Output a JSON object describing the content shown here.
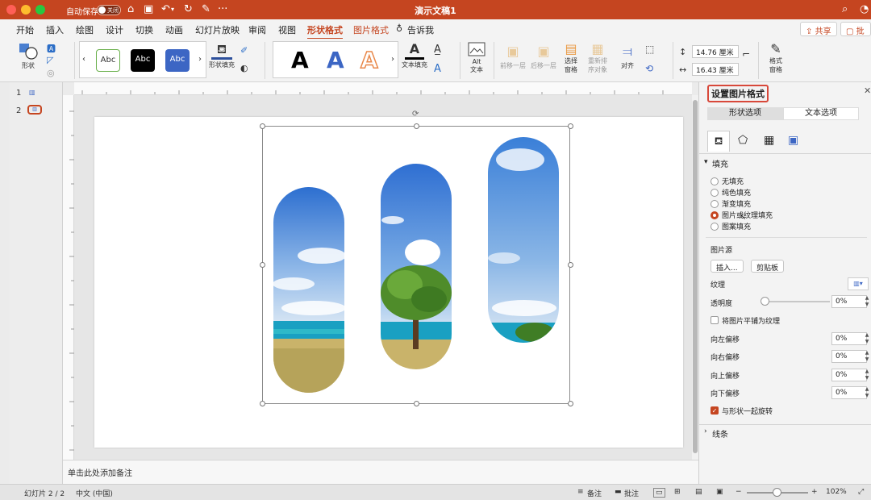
{
  "titlebar": {
    "autosave_label": "自动保存",
    "autosave_state": "关闭",
    "title": "演示文稿1"
  },
  "tabs": [
    {
      "label": "开始"
    },
    {
      "label": "插入"
    },
    {
      "label": "绘图"
    },
    {
      "label": "设计"
    },
    {
      "label": "切换"
    },
    {
      "label": "动画"
    },
    {
      "label": "幻灯片放映"
    },
    {
      "label": "审阅"
    },
    {
      "label": "视图"
    },
    {
      "label": "形状格式"
    },
    {
      "label": "图片格式"
    }
  ],
  "tellme": "告诉我",
  "share": "共享",
  "comments_btn": "批注",
  "ribbon": {
    "shape": "形状",
    "abc": "Abc",
    "shape_fill": "形状填充",
    "text_fill": "文本填充",
    "alt_text_1": "Alt",
    "alt_text_2": "文本",
    "bring_forward": "前移一层",
    "send_backward": "后移一层",
    "select_pane_1": "选择",
    "select_pane_2": "窗格",
    "reorder_1": "重新排",
    "reorder_2": "序对象",
    "align": "对齐",
    "height": "14.76 厘米",
    "width": "16.43 厘米",
    "format_pane_1": "格式",
    "format_pane_2": "窗格"
  },
  "thumbs": [
    "1",
    "2"
  ],
  "notes_placeholder": "单击此处添加备注",
  "panel": {
    "title": "设置图片格式",
    "tab_shape": "形状选项",
    "tab_text": "文本选项",
    "fill_section": "填充",
    "fill_options": [
      "无填充",
      "纯色填充",
      "渐变填充",
      "图片或纹理填充",
      "图案填充"
    ],
    "picture_source": "图片源",
    "insert_btn": "插入...",
    "clipboard_btn": "剪贴板",
    "texture": "纹理",
    "transparency": "透明度",
    "transparency_value": "0%",
    "tile_label": "将图片平铺为纹理",
    "offset_left": "向左偏移",
    "offset_right": "向右偏移",
    "offset_top": "向上偏移",
    "offset_bottom": "向下偏移",
    "offset_value": "0%",
    "rotate_label": "与形状一起旋转",
    "line_section": "线条"
  },
  "status": {
    "slide": "幻灯片 2 / 2",
    "language": "中文 (中国)",
    "notes": "备注",
    "comments": "批注",
    "zoom": "102%"
  },
  "colors": {
    "accent": "#c54520",
    "titlebar": "#c54520",
    "sky": "#3f82d6",
    "sea": "#1aa0c2",
    "sand": "#c9b36a"
  }
}
